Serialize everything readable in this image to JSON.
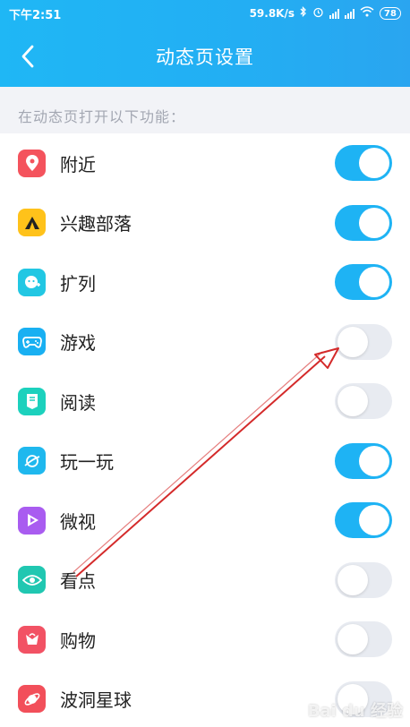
{
  "status_bar": {
    "time": "下午2:51",
    "network_speed": "59.8K/s",
    "battery_level": "78"
  },
  "nav": {
    "title": "动态页设置"
  },
  "section": {
    "label": "在动态页打开以下功能："
  },
  "items": [
    {
      "label": "附近",
      "enabled": true,
      "icon": "location-pin-icon",
      "color": "#f4535d"
    },
    {
      "label": "兴趣部落",
      "enabled": true,
      "icon": "tent-icon",
      "color": "#ffc21a"
    },
    {
      "label": "扩列",
      "enabled": true,
      "icon": "face-plus-icon",
      "color": "#22c7e3"
    },
    {
      "label": "游戏",
      "enabled": false,
      "icon": "gamepad-icon",
      "color": "#19b0f2"
    },
    {
      "label": "阅读",
      "enabled": false,
      "icon": "book-icon",
      "color": "#1cd1bd"
    },
    {
      "label": "玩一玩",
      "enabled": true,
      "icon": "planet-icon",
      "color": "#1fb8ee"
    },
    {
      "label": "微视",
      "enabled": true,
      "icon": "play-icon",
      "color": "#a95cf0"
    },
    {
      "label": "看点",
      "enabled": false,
      "icon": "eye-icon",
      "color": "#20c7b1"
    },
    {
      "label": "购物",
      "enabled": false,
      "icon": "bag-icon",
      "color": "#f25264"
    },
    {
      "label": "波洞星球",
      "enabled": false,
      "icon": "planet-ring-icon",
      "color": "#f24f5a"
    }
  ],
  "colors": {
    "header": "#23aef3",
    "toggle_on": "#1eb3f4",
    "toggle_off": "#e8ebf1",
    "annotation_arrow": "#d42a2a"
  },
  "watermark": "Bai du 经验"
}
